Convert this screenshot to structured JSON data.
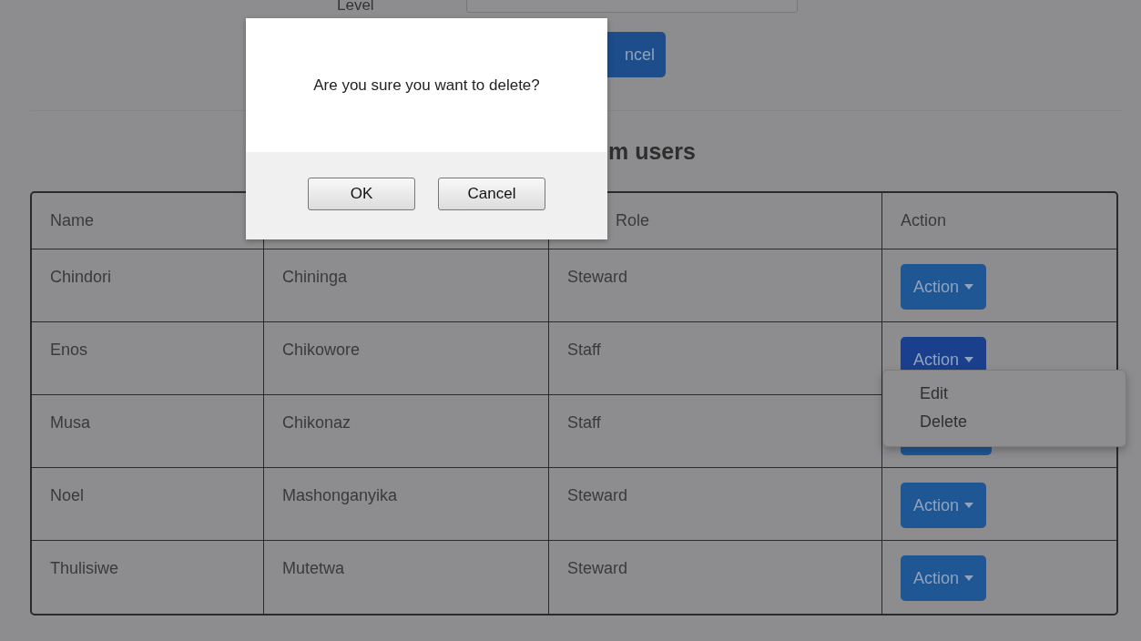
{
  "form": {
    "level_label": "Level",
    "cancel_button": "ncel"
  },
  "heading": "m users",
  "table": {
    "columns": [
      "Name",
      "",
      "Role",
      "Action"
    ],
    "rows": [
      {
        "name": "Chindori",
        "surname": "Chininga",
        "role": "Steward",
        "action": "Action",
        "open": false
      },
      {
        "name": "Enos",
        "surname": "Chikowore",
        "role": "Staff",
        "action": "Action",
        "open": true
      },
      {
        "name": "Musa",
        "surname": "Chikonaz",
        "role": "Staff",
        "open": false
      },
      {
        "name": "Noel",
        "surname": "Mashonganyika",
        "role": "Steward",
        "action": "Action",
        "open": false
      },
      {
        "name": "Thulisiwe",
        "surname": "Mutetwa",
        "role": "Steward",
        "action": "Action",
        "open": false
      }
    ]
  },
  "menu": [
    "Edit",
    "Delete"
  ],
  "dialog": {
    "message": "Are you sure you want to delete?",
    "buttons": [
      "OK",
      "Cancel"
    ]
  }
}
